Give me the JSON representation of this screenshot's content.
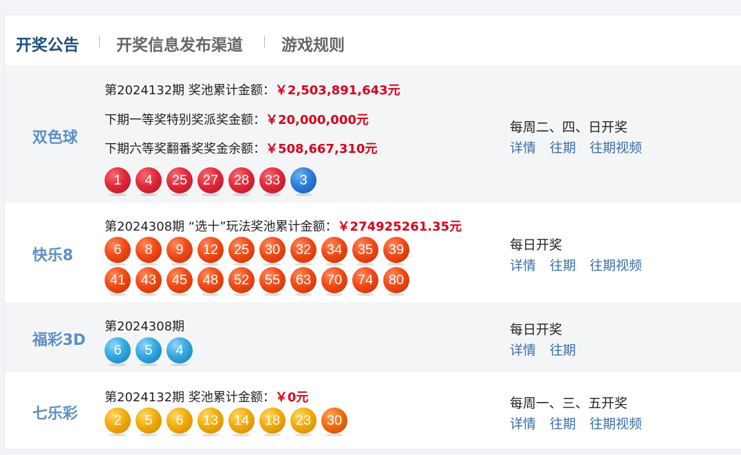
{
  "tabs": [
    "开奖公告",
    "开奖信息发布渠道",
    "游戏规则"
  ],
  "ssq": {
    "name": "双色球",
    "issue_line_prefix": "第2024132期  奖池累计金额：",
    "pool": "￥2,503,891,643元",
    "first_prize_label": "下期一等奖特别奖派奖金额：",
    "first_prize": "￥20,000,000元",
    "sixth_prize_label": "下期六等奖翻番奖奖金余额：",
    "sixth_prize": "￥508,667,310元",
    "red_balls": [
      "1",
      "4",
      "25",
      "27",
      "28",
      "33"
    ],
    "blue_balls": [
      "3"
    ],
    "schedule": "每周二、四、日开奖",
    "links": [
      "详情",
      "往期",
      "往期视频"
    ]
  },
  "kl8": {
    "name": "快乐8",
    "issue_line_prefix": "第2024308期 “选十”玩法奖池累计金额：",
    "pool": "￥274925261.35元",
    "balls_row1": [
      "6",
      "8",
      "9",
      "12",
      "25",
      "30",
      "32",
      "34",
      "35",
      "39"
    ],
    "balls_row2": [
      "41",
      "43",
      "45",
      "48",
      "52",
      "55",
      "63",
      "70",
      "74",
      "80"
    ],
    "schedule": "每日开奖",
    "links": [
      "详情",
      "往期",
      "往期视频"
    ]
  },
  "fc3d": {
    "name": "福彩3D",
    "issue": "第2024308期",
    "balls": [
      "6",
      "5",
      "4"
    ],
    "schedule": "每日开奖",
    "links": [
      "详情",
      "往期"
    ]
  },
  "qlc": {
    "name": "七乐彩",
    "issue_line_prefix": "第2024132期  奖池累计金额：",
    "pool": "￥0元",
    "basic_balls": [
      "2",
      "5",
      "6",
      "13",
      "14",
      "18",
      "23"
    ],
    "special_ball": "30",
    "schedule": "每周一、三、五开奖",
    "links": [
      "详情",
      "往期",
      "往期视频"
    ]
  }
}
